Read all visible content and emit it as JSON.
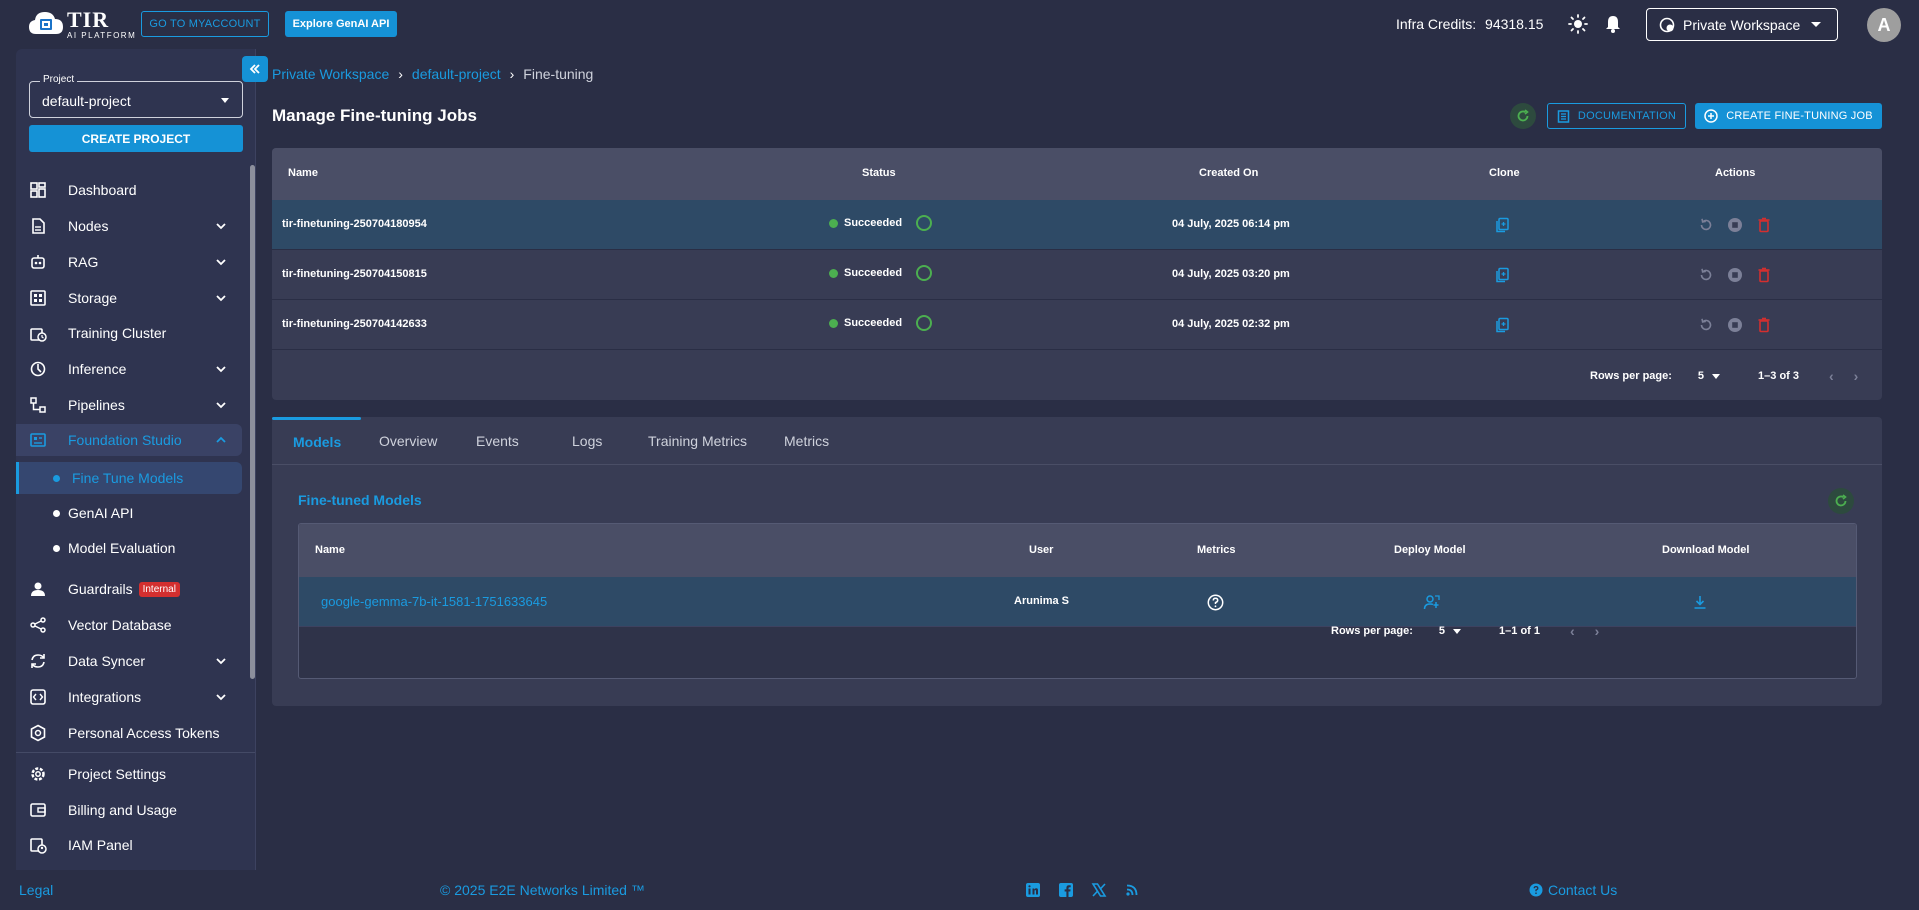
{
  "header": {
    "logo_title": "TIR",
    "logo_subtitle": "AI PLATFORM",
    "myaccount_label": "GO TO MYACCOUNT",
    "genai_label": "Explore GenAI API",
    "credits_label": "Infra Credits:",
    "credits_value": "94318.15",
    "workspace": "Private Workspace",
    "avatar_letter": "A"
  },
  "sidebar": {
    "project_label": "Project",
    "project_value": "default-project",
    "create_project": "CREATE PROJECT",
    "items": [
      {
        "label": "Dashboard"
      },
      {
        "label": "Nodes"
      },
      {
        "label": "RAG"
      },
      {
        "label": "Storage"
      },
      {
        "label": "Training Cluster"
      },
      {
        "label": "Inference"
      },
      {
        "label": "Pipelines"
      },
      {
        "label": "Foundation Studio"
      },
      {
        "label": "Fine Tune Models"
      },
      {
        "label": "GenAI API"
      },
      {
        "label": "Model Evaluation"
      },
      {
        "label": "Guardrails"
      },
      {
        "label": "Vector Database"
      },
      {
        "label": "Data Syncer"
      },
      {
        "label": "Integrations"
      },
      {
        "label": "Personal Access Tokens"
      },
      {
        "label": "Project Settings"
      },
      {
        "label": "Billing and Usage"
      },
      {
        "label": "IAM Panel"
      }
    ],
    "guardrails_badge": "Internal"
  },
  "breadcrumb": [
    "Private Workspace",
    "default-project",
    "Fine-tuning"
  ],
  "page_title": "Manage Fine-tuning Jobs",
  "buttons": {
    "documentation": "DOCUMENTATION",
    "create_job": "CREATE FINE-TUNING JOB"
  },
  "jobs_table": {
    "columns": [
      "Name",
      "Status",
      "Created On",
      "Clone",
      "Actions"
    ],
    "rows": [
      {
        "name": "tir-finetuning-250704180954",
        "status": "Succeeded",
        "created": "04 July, 2025 06:14 pm"
      },
      {
        "name": "tir-finetuning-250704150815",
        "status": "Succeeded",
        "created": "04 July, 2025 03:20 pm"
      },
      {
        "name": "tir-finetuning-250704142633",
        "status": "Succeeded",
        "created": "04 July, 2025 02:32 pm"
      }
    ],
    "rows_per_page_label": "Rows per page:",
    "rows_per_page": "5",
    "range": "1–3 of 3"
  },
  "tabs": [
    "Models",
    "Overview",
    "Events",
    "Logs",
    "Training Metrics",
    "Metrics"
  ],
  "models_section": {
    "title": "Fine-tuned Models",
    "columns": [
      "Name",
      "User",
      "Metrics",
      "Deploy Model",
      "Download Model"
    ],
    "rows": [
      {
        "name": "google-gemma-7b-it-1581-1751633645",
        "user": "Arunima S"
      }
    ],
    "rows_per_page_label": "Rows per page:",
    "rows_per_page": "5",
    "range": "1–1 of 1"
  },
  "footer": {
    "legal": "Legal",
    "copyright": "© 2025 E2E Networks Limited ™",
    "contact": "Contact Us"
  },
  "colors": {
    "accent": "#1592d6",
    "background": "#2a2e45",
    "success": "#4caf50",
    "danger": "#d32f2f"
  }
}
